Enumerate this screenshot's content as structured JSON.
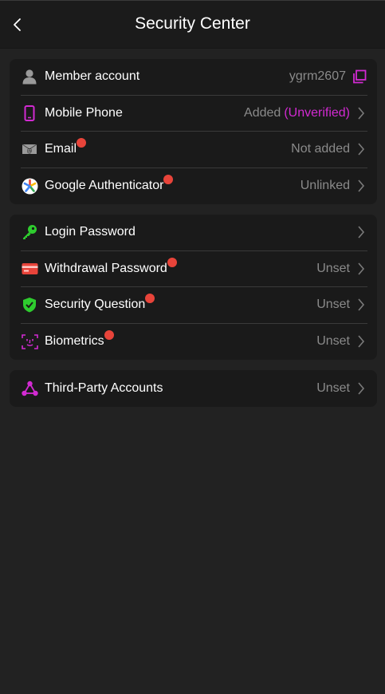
{
  "header": {
    "title": "Security Center"
  },
  "colors": {
    "accent": "#d22ad2",
    "green": "#2ecc2e",
    "red_dot": "#e8443a",
    "wallet_red": "#e8443a"
  },
  "groups": [
    {
      "items": [
        {
          "label": "Member account",
          "value": "ygrm2607",
          "icon": "user-icon"
        },
        {
          "label": "Mobile Phone",
          "value": "Added",
          "value_accent": "(Unverified)",
          "icon": "phone-icon"
        },
        {
          "label": "Email",
          "value": "Not added",
          "icon": "envelope-icon"
        },
        {
          "label": "Google Authenticator",
          "value": "Unlinked",
          "icon": "google-authenticator-icon"
        }
      ]
    },
    {
      "items": [
        {
          "label": "Login Password",
          "value": "",
          "icon": "key-icon"
        },
        {
          "label": "Withdrawal Password",
          "value": "Unset",
          "icon": "card-icon"
        },
        {
          "label": "Security Question",
          "value": "Unset",
          "icon": "shield-check-icon"
        },
        {
          "label": "Biometrics",
          "value": "Unset",
          "icon": "face-scan-icon"
        }
      ]
    },
    {
      "items": [
        {
          "label": "Third-Party Accounts",
          "value": "Unset",
          "icon": "share-nodes-icon"
        }
      ]
    }
  ]
}
